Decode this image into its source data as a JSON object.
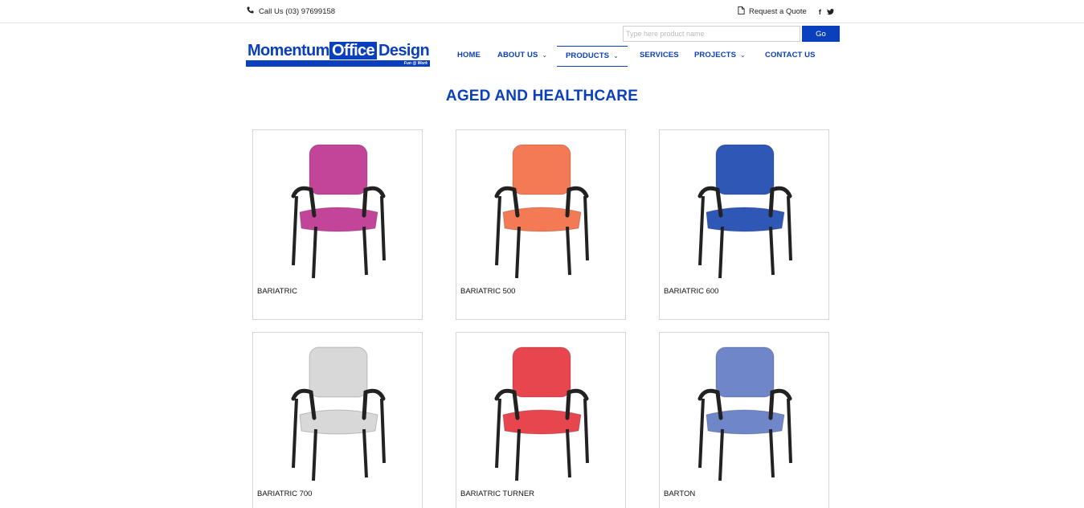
{
  "topbar": {
    "phone_label": "Call Us (03) 97699158",
    "quote_label": "Request a Quote",
    "facebook": "f",
    "twitter": "t"
  },
  "logo": {
    "word1": "Momentum",
    "word2": "Office",
    "word3": "Design",
    "tagline": "Fun @ Work"
  },
  "search": {
    "placeholder": "Type here product name",
    "button_label": "Go"
  },
  "nav": {
    "home": "HOME",
    "about": "ABOUT US",
    "products": "PRODUCTS",
    "services": "SERVICES",
    "projects": "PROJECTS",
    "contact": "CONTACT US",
    "chevron": "⌄"
  },
  "page": {
    "title": "AGED AND HEALTHCARE"
  },
  "products": [
    {
      "name": "BARIATRIC",
      "icon": "chair-icon",
      "color": "#c2459a"
    },
    {
      "name": "BARIATRIC 500",
      "icon": "chair-icon",
      "color": "#f37a55"
    },
    {
      "name": "BARIATRIC 600",
      "icon": "chair-icon",
      "color": "#2f57b5"
    },
    {
      "name": "BARIATRIC 700",
      "icon": "chair-icon",
      "color": "#d8d8d8"
    },
    {
      "name": "BARIATRIC TURNER",
      "icon": "chair-icon",
      "color": "#e8464f"
    },
    {
      "name": "BARTON",
      "icon": "chair-icon",
      "color": "#6f86c8"
    }
  ],
  "colors": {
    "brand": "#0a3fbd"
  }
}
